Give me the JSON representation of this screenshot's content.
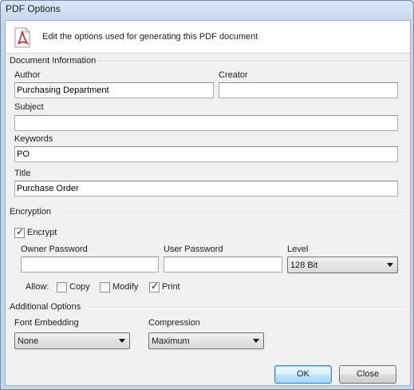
{
  "window": {
    "title": "PDF Options"
  },
  "banner": {
    "icon": "pdf-icon",
    "text": "Edit the options used for generating this PDF document"
  },
  "document_info": {
    "heading": "Document Information",
    "author_label": "Author",
    "author_value": "Purchasing Department",
    "creator_label": "Creator",
    "creator_value": "",
    "subject_label": "Subject",
    "subject_value": "",
    "keywords_label": "Keywords",
    "keywords_value": "PO",
    "title_label": "Title",
    "title_value": "Purchase Order"
  },
  "encryption": {
    "heading": "Encryption",
    "encrypt_label": "Encrypt",
    "encrypt_checked": true,
    "owner_password_label": "Owner Password",
    "owner_password_value": "",
    "user_password_label": "User Password",
    "user_password_value": "",
    "level_label": "Level",
    "level_value": "128 Bit",
    "allow_label": "Allow:",
    "copy_label": "Copy",
    "copy_checked": false,
    "modify_label": "Modify",
    "modify_checked": false,
    "print_label": "Print",
    "print_checked": true
  },
  "additional": {
    "heading": "Additional Options",
    "font_embedding_label": "Font Embedding",
    "font_embedding_value": "None",
    "compression_label": "Compression",
    "compression_value": "Maximum"
  },
  "buttons": {
    "ok_label": "OK",
    "close_label": "Close"
  },
  "colors": {
    "window_frame": "#c4d6ea",
    "dialog_bg": "#f0f0f0",
    "pdf_red": "#c8262a",
    "default_button": "#bee6fd"
  }
}
